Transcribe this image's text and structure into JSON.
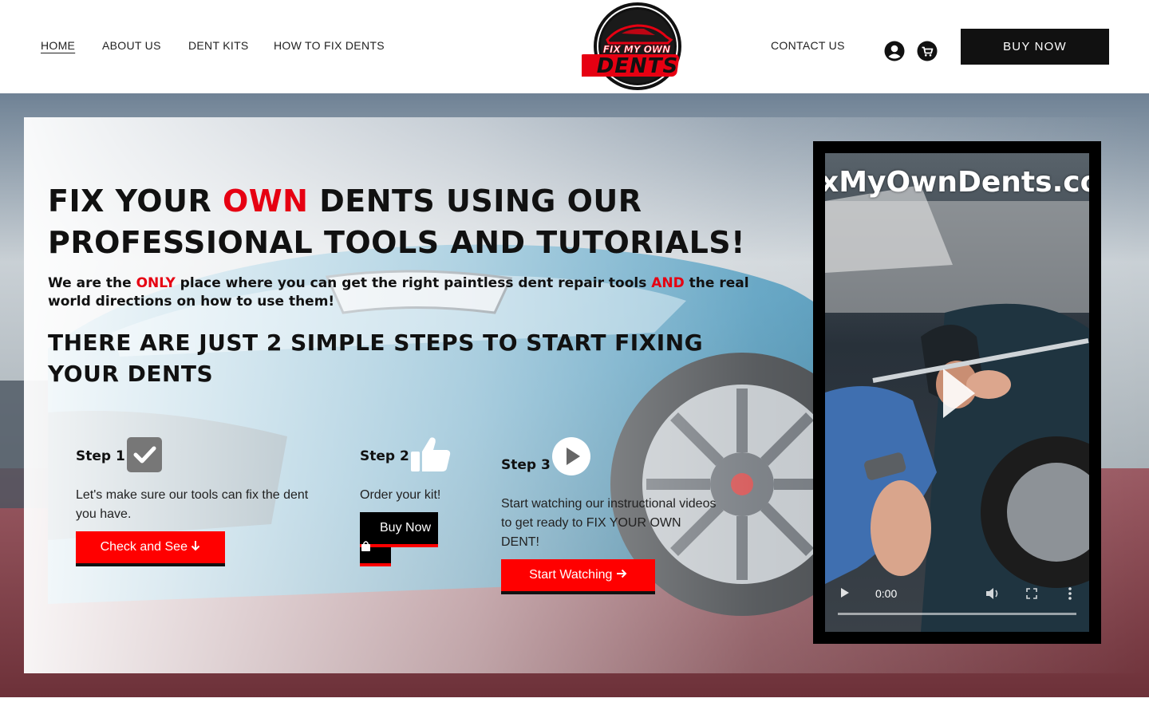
{
  "header": {
    "nav_left": [
      "HOME",
      "ABOUT US",
      "DENT KITS",
      "HOW TO FIX DENTS"
    ],
    "nav_right": "CONTACT US",
    "logo_text_top": "FIX MY OWN",
    "logo_text_main": "DENTS",
    "account_icon": "user-circle-icon",
    "cart_icon": "cart-icon",
    "buy_now": "BUY NOW"
  },
  "hero": {
    "headline_a": "FIX YOUR ",
    "headline_b": "OWN",
    "headline_c": " DENTS USING OUR PROFESSIONAL TOOLS AND TUTORIALS!",
    "sub_a": "We are the ",
    "sub_b": "ONLY",
    "sub_c": " place where you can get the right paintless dent repair tools ",
    "sub_d": "AND",
    "sub_e": " the real world directions on how to use them!",
    "steps_heading": "THERE ARE JUST 2 SIMPLE STEPS TO START FIXING YOUR DENTS"
  },
  "steps": [
    {
      "title": "Step 1",
      "icon": "checkbox-icon",
      "text": "Let's make sure our tools can fix the dent you have.",
      "button": "Check and See",
      "button_icon": "arrow-down-icon"
    },
    {
      "title": "Step  2",
      "icon": "thumbs-up-icon",
      "text": "Order your kit!",
      "button": "Buy Now",
      "button_icon": "shopping-bag-icon"
    },
    {
      "title": "Step 3",
      "icon": "play-circle-icon",
      "text": "Start watching our instructional videos to get ready to FIX YOUR OWN DENT!",
      "button": "Start Watching",
      "button_icon": "arrow-right-icon"
    }
  ],
  "video": {
    "watermark": "xMyOwnDents.co",
    "time": "0:00",
    "progress": 0
  },
  "colors": {
    "accent_red": "#ff0000",
    "headline_red": "#e60012",
    "dark": "#111111"
  }
}
